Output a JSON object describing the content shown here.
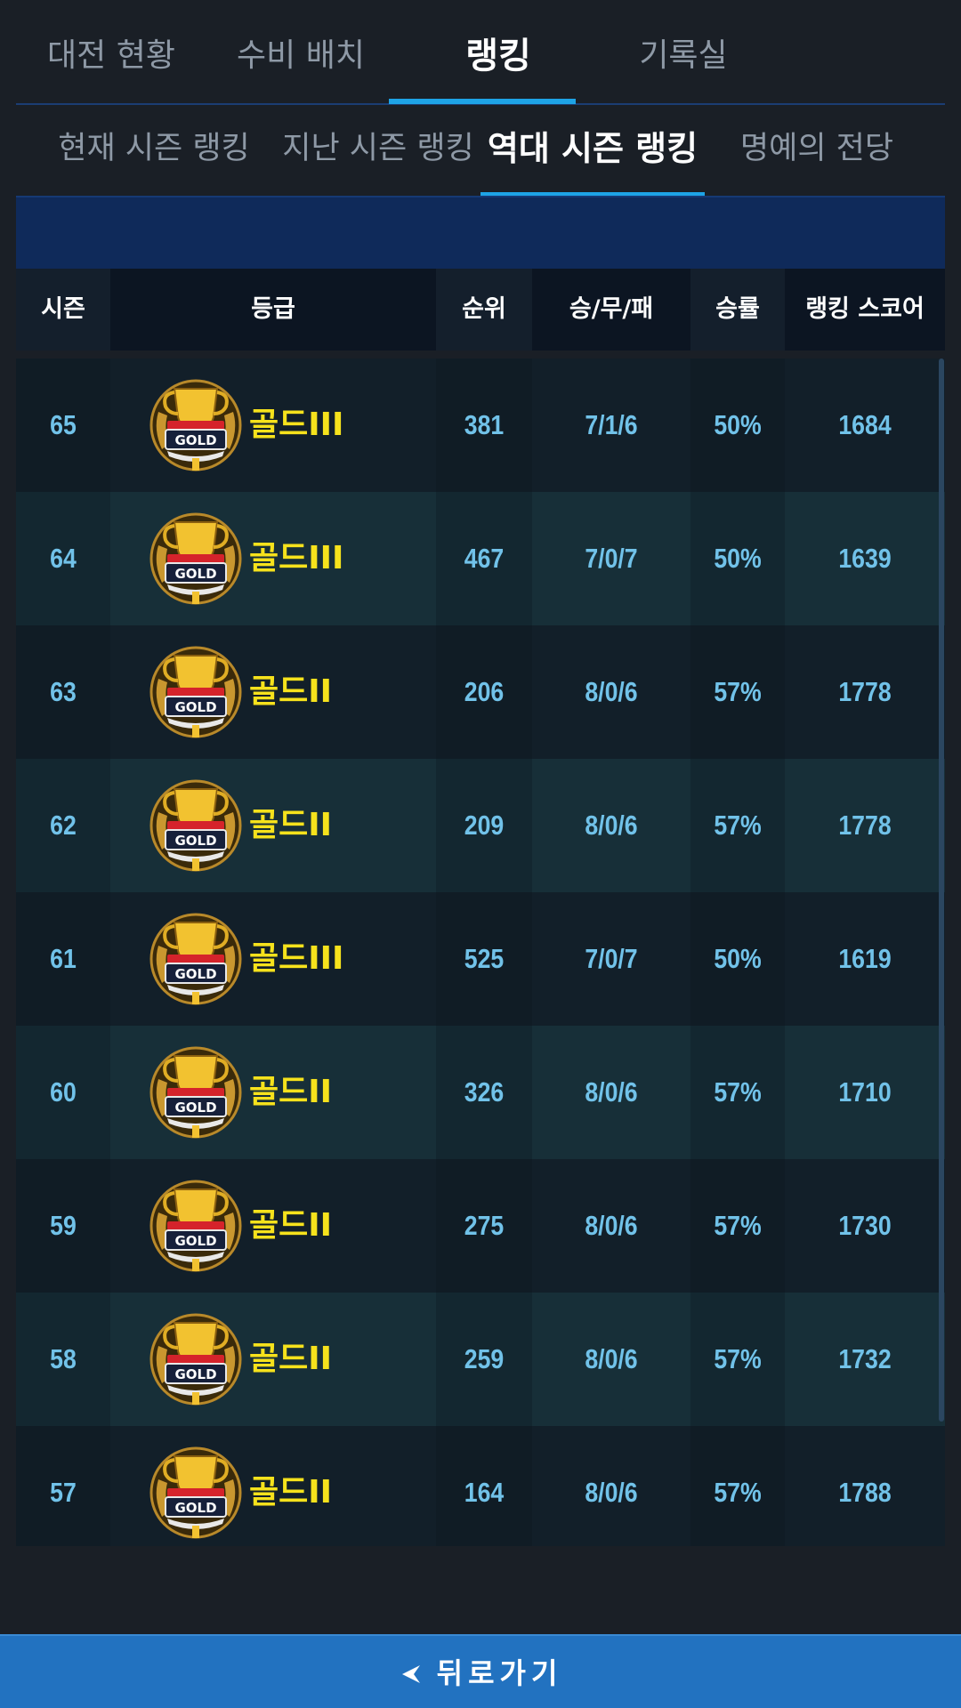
{
  "top_tabs": [
    {
      "label": "대전 현황"
    },
    {
      "label": "수비 배치"
    },
    {
      "label": "랭킹"
    },
    {
      "label": "기록실"
    }
  ],
  "sub_tabs": [
    {
      "label": "현재 시즌 랭킹"
    },
    {
      "label": "지난 시즌 랭킹"
    },
    {
      "label": "역대 시즌 랭킹"
    },
    {
      "label": "명예의 전당"
    }
  ],
  "table": {
    "headers": {
      "season": "시즌",
      "grade": "등급",
      "rank": "순위",
      "record": "승/무/패",
      "win_rate": "승률",
      "score": "랭킹 스코어"
    },
    "rows": [
      {
        "season": "65",
        "grade": "골드III",
        "rank": "381",
        "record": "7/1/6",
        "win_rate": "50%",
        "score": "1684"
      },
      {
        "season": "64",
        "grade": "골드III",
        "rank": "467",
        "record": "7/0/7",
        "win_rate": "50%",
        "score": "1639"
      },
      {
        "season": "63",
        "grade": "골드II",
        "rank": "206",
        "record": "8/0/6",
        "win_rate": "57%",
        "score": "1778"
      },
      {
        "season": "62",
        "grade": "골드II",
        "rank": "209",
        "record": "8/0/6",
        "win_rate": "57%",
        "score": "1778"
      },
      {
        "season": "61",
        "grade": "골드III",
        "rank": "525",
        "record": "7/0/7",
        "win_rate": "50%",
        "score": "1619"
      },
      {
        "season": "60",
        "grade": "골드II",
        "rank": "326",
        "record": "8/0/6",
        "win_rate": "57%",
        "score": "1710"
      },
      {
        "season": "59",
        "grade": "골드II",
        "rank": "275",
        "record": "8/0/6",
        "win_rate": "57%",
        "score": "1730"
      },
      {
        "season": "58",
        "grade": "골드II",
        "rank": "259",
        "record": "8/0/6",
        "win_rate": "57%",
        "score": "1732"
      },
      {
        "season": "57",
        "grade": "골드II",
        "rank": "164",
        "record": "8/0/6",
        "win_rate": "57%",
        "score": "1788"
      }
    ]
  },
  "emblem": {
    "text": "GOLD",
    "icon": "gold-trophy-icon"
  },
  "back_button": {
    "label": "뒤로가기"
  },
  "colors": {
    "background": "#1a1f26",
    "active_tab_underline": "#1ea3e6",
    "grade_text": "#f6e21c",
    "cell_text": "#71c2e9",
    "back_bar": "#2272c0"
  }
}
